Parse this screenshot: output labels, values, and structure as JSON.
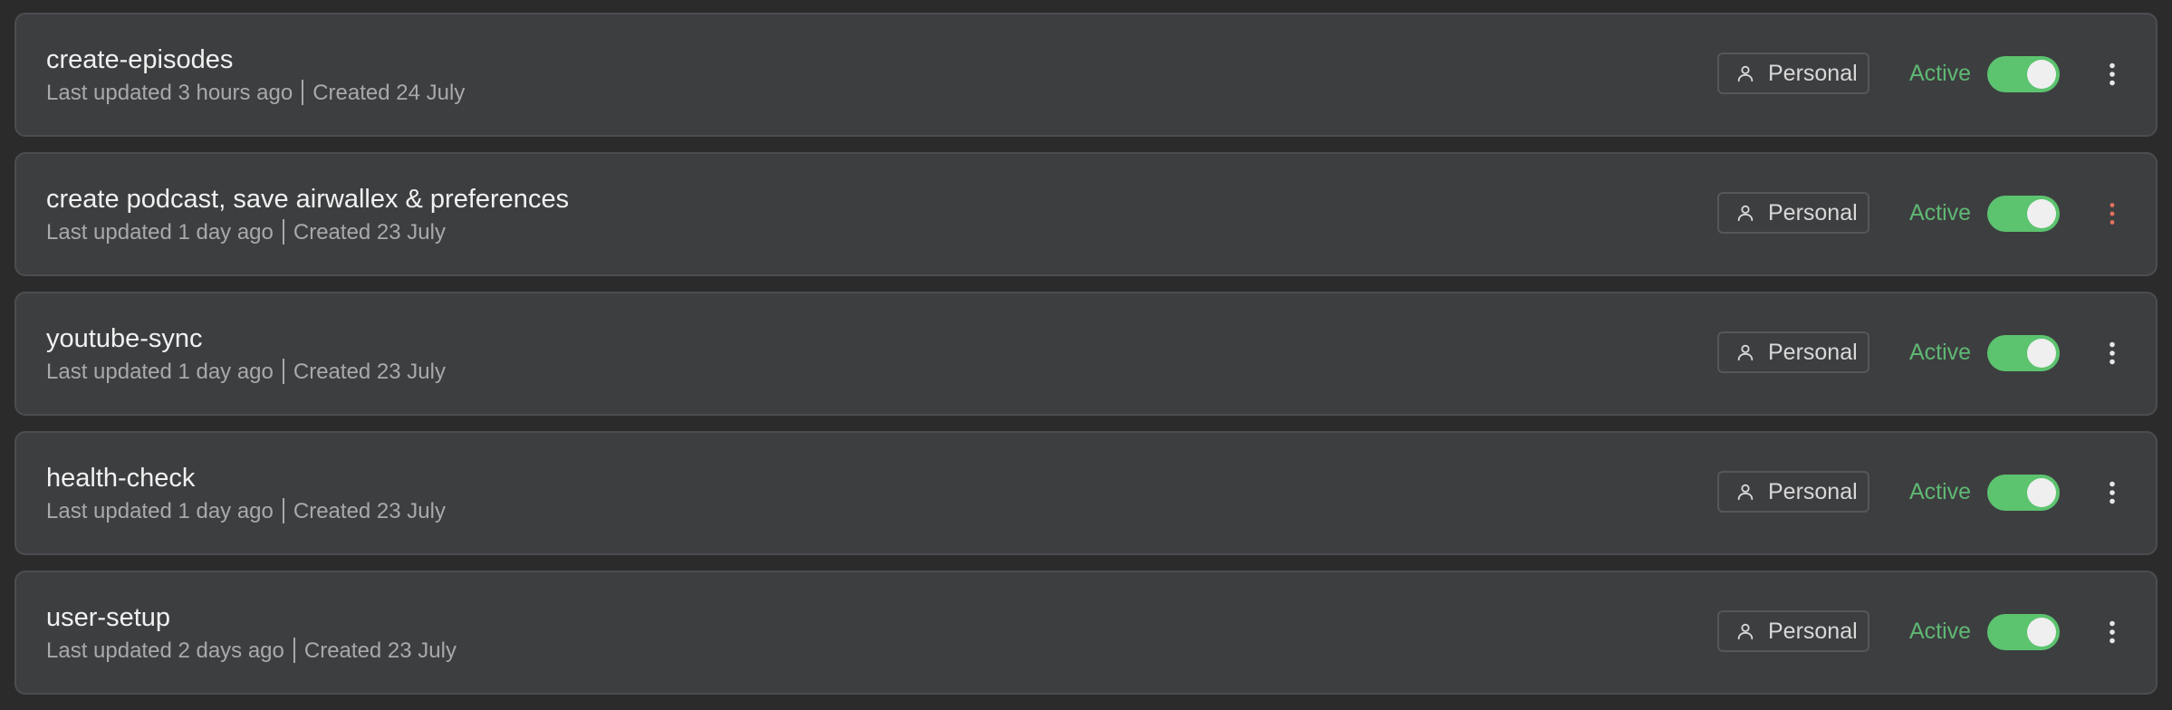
{
  "colors": {
    "active_green": "#5fb873",
    "toggle_on": "#5cc36f",
    "menu_highlight": "#e2735d",
    "menu_default": "#e8e8e8"
  },
  "rows": [
    {
      "title": "create-episodes",
      "updated": "Last updated 3 hours ago",
      "created": "Created 24 July",
      "badge": "Personal",
      "badge_icon": "user-icon",
      "status": "Active",
      "toggle_on": true,
      "menu_icon": "more-vertical-icon",
      "menu_highlighted": false
    },
    {
      "title": "create podcast, save airwallex & preferences",
      "updated": "Last updated 1 day ago",
      "created": "Created 23 July",
      "badge": "Personal",
      "badge_icon": "user-icon",
      "status": "Active",
      "toggle_on": true,
      "menu_icon": "more-vertical-icon",
      "menu_highlighted": true
    },
    {
      "title": "youtube-sync",
      "updated": "Last updated 1 day ago",
      "created": "Created 23 July",
      "badge": "Personal",
      "badge_icon": "user-icon",
      "status": "Active",
      "toggle_on": true,
      "menu_icon": "more-vertical-icon",
      "menu_highlighted": false
    },
    {
      "title": "health-check",
      "updated": "Last updated 1 day ago",
      "created": "Created 23 July",
      "badge": "Personal",
      "badge_icon": "user-icon",
      "status": "Active",
      "toggle_on": true,
      "menu_icon": "more-vertical-icon",
      "menu_highlighted": false
    },
    {
      "title": "user-setup",
      "updated": "Last updated 2 days ago",
      "created": "Created 23 July",
      "badge": "Personal",
      "badge_icon": "user-icon",
      "status": "Active",
      "toggle_on": true,
      "menu_icon": "more-vertical-icon",
      "menu_highlighted": false
    }
  ]
}
